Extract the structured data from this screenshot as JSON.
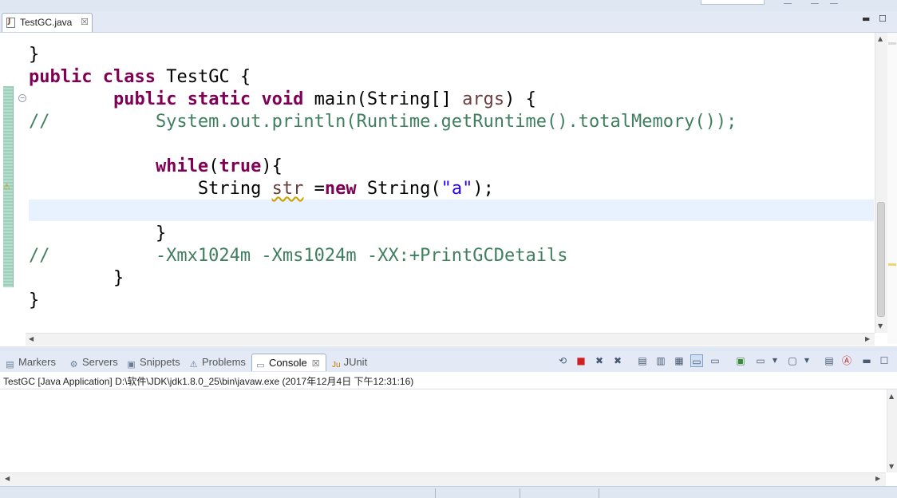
{
  "editor_tab": {
    "label": "TestGC.java",
    "close": "☒"
  },
  "code_lines": [
    [
      {
        "t": "}",
        "c": ""
      }
    ],
    [
      {
        "t": "public",
        "c": "kw"
      },
      {
        "t": " ",
        "c": ""
      },
      {
        "t": "class",
        "c": "kw"
      },
      {
        "t": " TestGC {",
        "c": ""
      }
    ],
    [
      {
        "t": "        ",
        "c": ""
      },
      {
        "t": "public",
        "c": "kw"
      },
      {
        "t": " ",
        "c": ""
      },
      {
        "t": "static",
        "c": "kw"
      },
      {
        "t": " ",
        "c": ""
      },
      {
        "t": "void",
        "c": "kw"
      },
      {
        "t": " main(String[] ",
        "c": ""
      },
      {
        "t": "args",
        "c": "pm"
      },
      {
        "t": ") {",
        "c": ""
      }
    ],
    [
      {
        "t": "//          System.out.println(Runtime.getRuntime().totalMemory());",
        "c": "cm"
      }
    ],
    [
      {
        "t": "",
        "c": ""
      }
    ],
    [
      {
        "t": "            ",
        "c": ""
      },
      {
        "t": "while",
        "c": "kw"
      },
      {
        "t": "(",
        "c": ""
      },
      {
        "t": "true",
        "c": "kw"
      },
      {
        "t": "){",
        "c": ""
      }
    ],
    [
      {
        "t": "                String ",
        "c": ""
      },
      {
        "t": "str",
        "c": "warnvar"
      },
      {
        "t": " =",
        "c": ""
      },
      {
        "t": "new",
        "c": "kw"
      },
      {
        "t": " String(",
        "c": ""
      },
      {
        "t": "\"a\"",
        "c": "st"
      },
      {
        "t": ");",
        "c": ""
      }
    ],
    [
      {
        "t": "",
        "c": ""
      }
    ],
    [
      {
        "t": "            }",
        "c": ""
      }
    ],
    [
      {
        "t": "//          -Xmx1024m -Xms1024m -XX:+PrintGCDetails",
        "c": "cm"
      }
    ],
    [
      {
        "t": "        }",
        "c": ""
      }
    ],
    [
      {
        "t": "}",
        "c": ""
      }
    ]
  ],
  "panel_tabs": [
    {
      "label": "Markers",
      "icon": "markers-icon",
      "glyph": "▤",
      "active": false
    },
    {
      "label": "Servers",
      "icon": "servers-icon",
      "glyph": "⚙",
      "active": false
    },
    {
      "label": "Snippets",
      "icon": "snippets-icon",
      "glyph": "▣",
      "active": false
    },
    {
      "label": "Problems",
      "icon": "problems-icon",
      "glyph": "⚠",
      "active": false
    },
    {
      "label": "Console",
      "icon": "console-icon",
      "glyph": "▭",
      "active": true
    },
    {
      "label": "JUnit",
      "icon": "junit-icon",
      "glyph": "Ju",
      "active": false
    }
  ],
  "console": {
    "title": "TestGC [Java Application] D:\\软件\\JDK\\jdk1.8.0_25\\bin\\javaw.exe (2017年12月4日 下午12:31:16)"
  },
  "colors": {
    "keyword": "#7f0055",
    "comment": "#3f7f5f",
    "string": "#2a00ff",
    "current_line": "#e8f2fe"
  }
}
